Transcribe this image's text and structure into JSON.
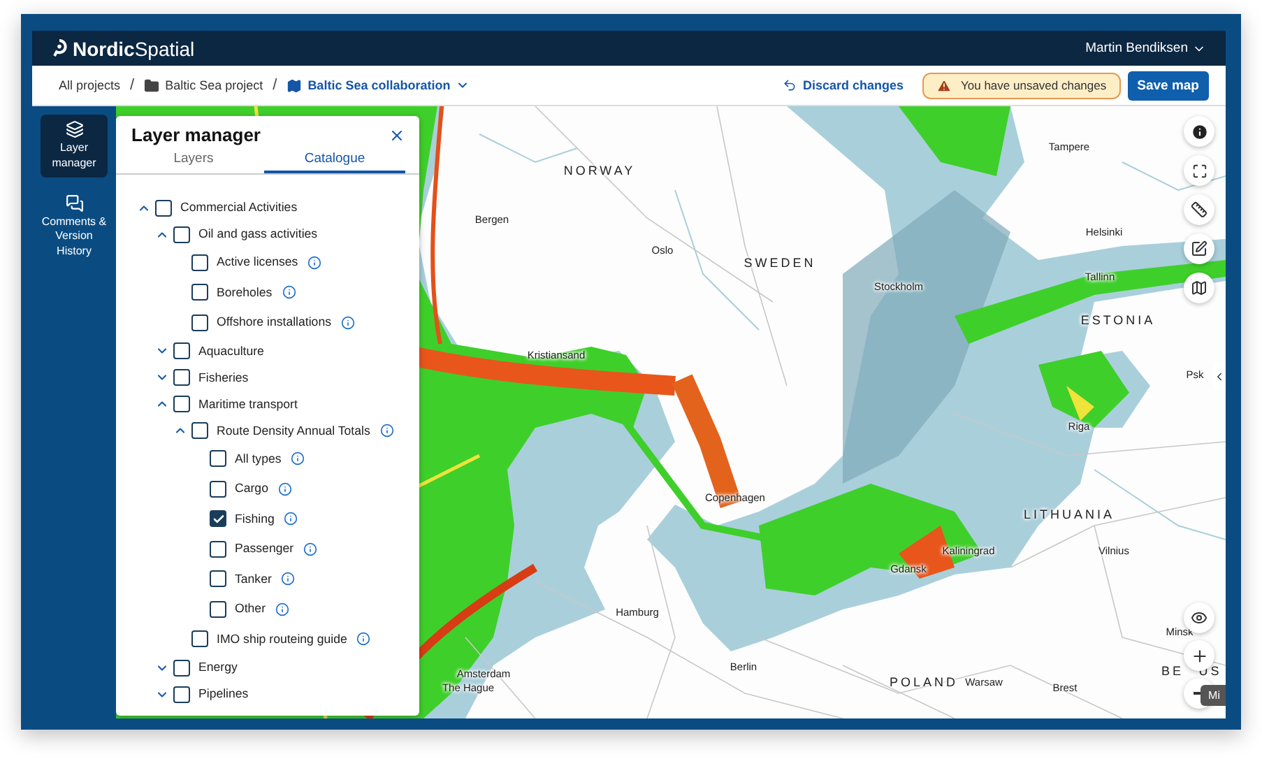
{
  "header": {
    "brand": "**Nordic**Spatial",
    "user": "Martin Bendiksen"
  },
  "breadcrumb": [
    {
      "label": "All projects",
      "kind": "plain"
    },
    {
      "label": "/",
      "kind": "separator"
    },
    {
      "label": "Baltic Sea project",
      "kind": "folder"
    },
    {
      "label": "/",
      "kind": "separator"
    },
    {
      "label": "Baltic Sea collaboration",
      "kind": "map"
    }
  ],
  "actions": {
    "discard": "Discard changes",
    "warning": "You have unsaved changes",
    "save": "Save map"
  },
  "sidebar": [
    {
      "label": "Layer manager",
      "kind": "layers",
      "selected": true
    },
    {
      "label": "Comments & Version History",
      "kind": "comments",
      "selected": false
    }
  ],
  "layer_manager": {
    "title": "Layer manager",
    "tabs": [
      {
        "label": "Layers",
        "selected": false
      },
      {
        "label": "Catalogue",
        "selected": true
      }
    ],
    "tree": [
      {
        "label": "Commercial Activities",
        "checked": false,
        "expanded": true,
        "info": false,
        "children": [
          {
            "label": "Oil and gass activities",
            "checked": false,
            "expanded": true,
            "info": false,
            "children": [
              {
                "label": "Active licenses",
                "checked": false,
                "info": true
              },
              {
                "label": "Boreholes",
                "checked": false,
                "info": true
              },
              {
                "label": "Offshore installations",
                "checked": false,
                "info": true
              }
            ]
          },
          {
            "label": "Aquaculture",
            "checked": false,
            "expanded": false,
            "info": false
          },
          {
            "label": "Fisheries",
            "checked": false,
            "expanded": false,
            "info": false
          },
          {
            "label": "Maritime transport",
            "checked": false,
            "expanded": true,
            "info": false,
            "children": [
              {
                "label": "Route Density Annual Totals",
                "checked": false,
                "expanded": true,
                "info": true,
                "children": [
                  {
                    "label": "All types",
                    "checked": false,
                    "info": true
                  },
                  {
                    "label": "Cargo",
                    "checked": false,
                    "info": true
                  },
                  {
                    "label": "Fishing",
                    "checked": true,
                    "info": true
                  },
                  {
                    "label": "Passenger",
                    "checked": false,
                    "info": true
                  },
                  {
                    "label": "Tanker",
                    "checked": false,
                    "info": true
                  },
                  {
                    "label": "Other",
                    "checked": false,
                    "info": true
                  }
                ]
              },
              {
                "label": "IMO ship routeing guide",
                "checked": false,
                "info": true
              }
            ]
          },
          {
            "label": "Energy",
            "checked": false,
            "expanded": false,
            "info": false
          },
          {
            "label": "Pipelines",
            "checked": false,
            "expanded": false,
            "info": false
          }
        ]
      }
    ]
  },
  "map_labels": [
    {
      "text": "NORWAY",
      "kind": "country"
    },
    {
      "text": "Bergen",
      "kind": "city"
    },
    {
      "text": "Oslo",
      "kind": "city"
    },
    {
      "text": "SWEDEN",
      "kind": "country"
    },
    {
      "text": "Stockholm",
      "kind": "city"
    },
    {
      "text": "Tampere",
      "kind": "city"
    },
    {
      "text": "Helsinki",
      "kind": "city"
    },
    {
      "text": "Tallinn",
      "kind": "city"
    },
    {
      "text": "ESTONIA",
      "kind": "country"
    },
    {
      "text": "Psk",
      "kind": "city"
    },
    {
      "text": "Kristiansand",
      "kind": "city"
    },
    {
      "text": "Riga",
      "kind": "city"
    },
    {
      "text": "Copenhagen",
      "kind": "city"
    },
    {
      "text": "LITHUANIA",
      "kind": "country"
    },
    {
      "text": "Kaliningrad",
      "kind": "city"
    },
    {
      "text": "Gdansk",
      "kind": "city"
    },
    {
      "text": "Vilnius",
      "kind": "city"
    },
    {
      "text": "Hamburg",
      "kind": "city"
    },
    {
      "text": "Minsk",
      "kind": "city"
    },
    {
      "text": "BE",
      "kind": "country"
    },
    {
      "text": "US",
      "kind": "country"
    },
    {
      "text": "Berlin",
      "kind": "city"
    },
    {
      "text": "Amsterdam",
      "kind": "city"
    },
    {
      "text": "The Hague",
      "kind": "city"
    },
    {
      "text": "POLAND",
      "kind": "country"
    },
    {
      "text": "Warsaw",
      "kind": "city"
    },
    {
      "text": "Brest",
      "kind": "city"
    }
  ],
  "map_tooltip": "Mi"
}
